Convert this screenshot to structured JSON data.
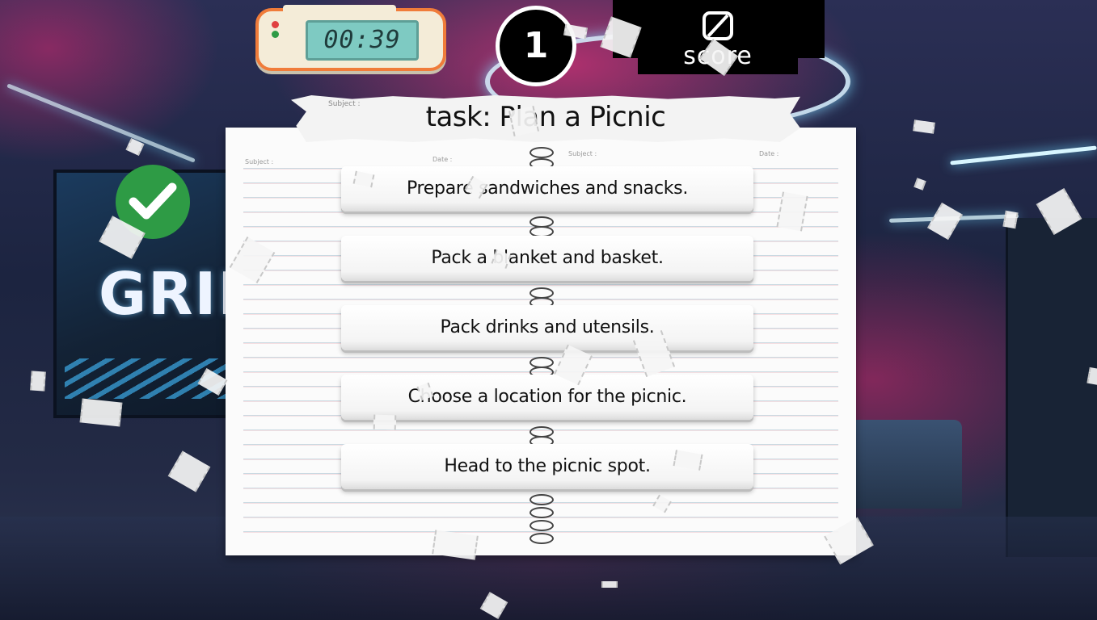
{
  "timer": {
    "value": "00:39"
  },
  "level": {
    "number": "1"
  },
  "score": {
    "label": "score",
    "icon": "skip-icon"
  },
  "task": {
    "title": "task: Plan a Picnic"
  },
  "notebook": {
    "header_subject": "Subject :",
    "header_date": "Date :"
  },
  "steps": [
    {
      "label": "Prepare sandwiches and snacks."
    },
    {
      "label": "Pack a blanket and basket."
    },
    {
      "label": "Pack drinks and utensils."
    },
    {
      "label": "Choose a location for the picnic."
    },
    {
      "label": "Head to the picnic spot."
    }
  ],
  "background": {
    "screen_text": "GRID"
  },
  "status": {
    "completed_icon": "checkmark-icon"
  },
  "colors": {
    "timer_border": "#f07c3a",
    "timer_screen": "#7ecac2",
    "check_green": "#2e9b45",
    "neon_pink": "#d8286e"
  }
}
